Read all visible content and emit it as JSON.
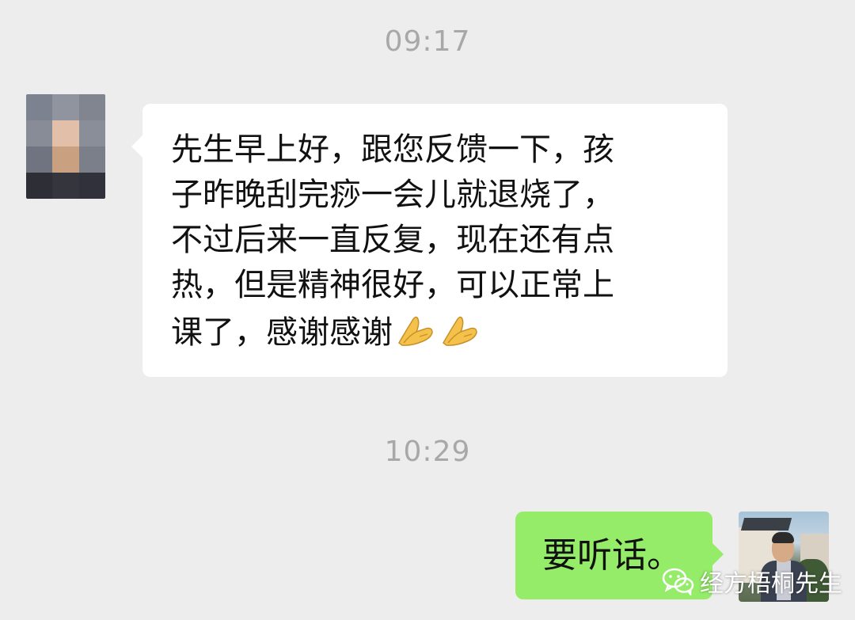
{
  "timestamps": [
    "09:17",
    "10:29"
  ],
  "messages": [
    {
      "sender": "other",
      "lines": [
        "先生早上好，跟您反馈一下，孩",
        "子昨晚刮完痧一会儿就退烧了，",
        "不过后来一直反复，现在还有点",
        "热，但是精神很好，可以正常上",
        "课了，感谢感谢"
      ],
      "trailing_emoji": [
        "folded-hands-emoji",
        "folded-hands-emoji"
      ]
    },
    {
      "sender": "self",
      "text": "要听话。"
    }
  ],
  "watermark": {
    "icon": "wechat-logo-icon",
    "text": "经方梧桐先生"
  },
  "colors": {
    "background": "#ededed",
    "incoming_bubble": "#ffffff",
    "outgoing_bubble": "#95ec69",
    "timestamp_text": "#a8a8a8",
    "message_text": "#111111"
  }
}
